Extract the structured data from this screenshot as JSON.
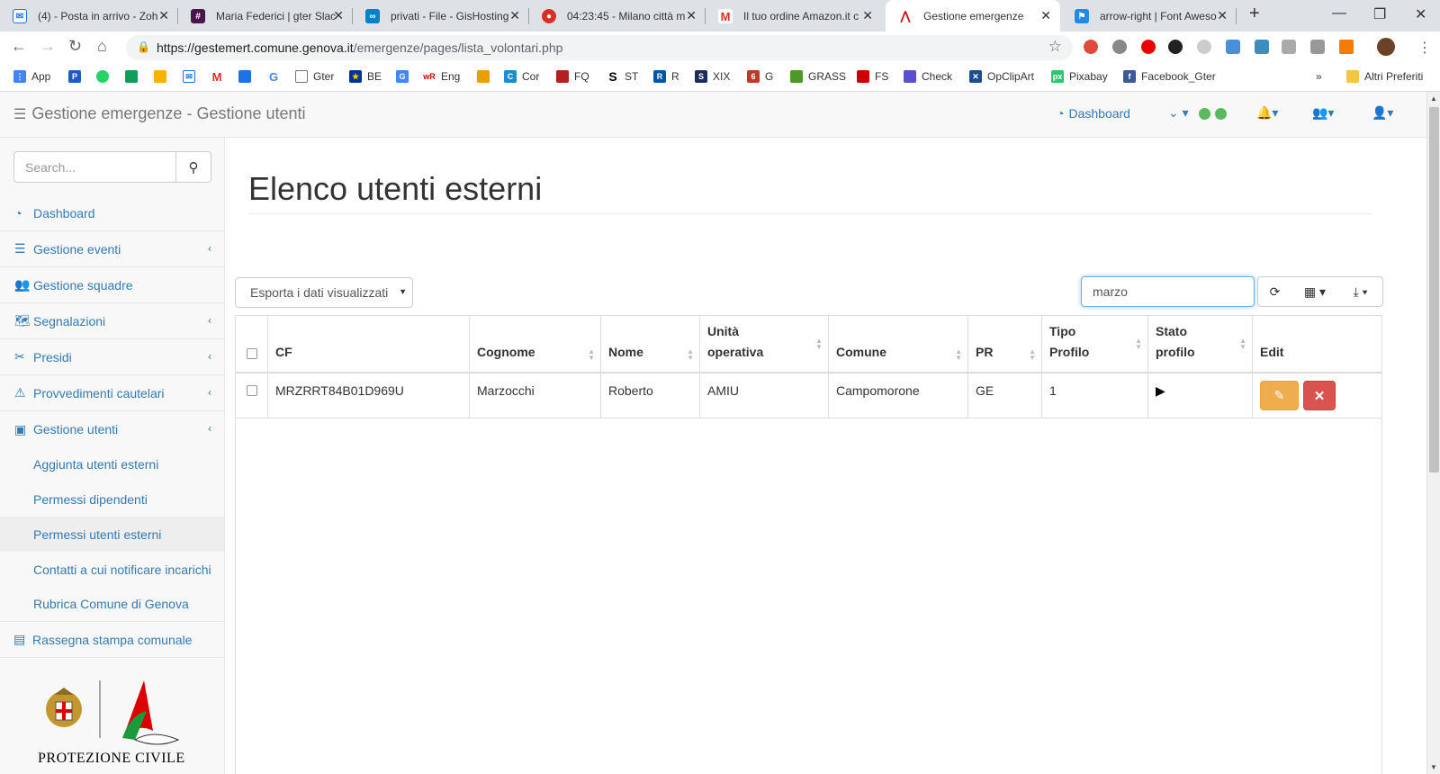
{
  "browser": {
    "tabs": [
      {
        "title": "(4) - Posta in arrivo - Zoh",
        "favicon": "mail-icon",
        "color": "#1a73e8"
      },
      {
        "title": "Maria Federici | gter Slac",
        "favicon": "slack-icon",
        "color": "#4a154b"
      },
      {
        "title": "privati - File - GisHosting",
        "favicon": "nextcloud-icon",
        "color": "#0082c9"
      },
      {
        "title": "04:23:45 - Milano città m",
        "favicon": "record-icon",
        "color": "#d93025"
      },
      {
        "title": "Il tuo ordine Amazon.it c",
        "favicon": "gmail-icon",
        "color": "#d93025"
      },
      {
        "title": "Gestione emergenze",
        "favicon": "protezione-civile-icon",
        "color": "#c00"
      },
      {
        "title": "arrow-right | Font Aweso",
        "favicon": "fontawesome-icon",
        "color": "#228ae6"
      }
    ],
    "url_host": "https://gestemert.comune.genova.it",
    "url_path": "/emergenze/pages/lista_volontari.php",
    "bookmarks": [
      {
        "label": "App",
        "color": "#4285f4"
      },
      {
        "label": "",
        "color": "#1e5bc6"
      },
      {
        "label": "",
        "color": "#25d366"
      },
      {
        "label": "",
        "color": "#fbbc04"
      },
      {
        "label": "",
        "color": "#f4b400"
      },
      {
        "label": "",
        "color": "#1a73e8"
      },
      {
        "label": "",
        "color": "#d93025"
      },
      {
        "label": "",
        "color": "#1a73e8"
      },
      {
        "label": "",
        "color": "#4285f4"
      },
      {
        "label": "Gter",
        "color": "#777"
      },
      {
        "label": "BE",
        "color": "#003399"
      },
      {
        "label": "",
        "color": "#4285f4"
      },
      {
        "label": "Eng",
        "color": "#c00"
      },
      {
        "label": "",
        "color": "#e8a000"
      },
      {
        "label": "Cor",
        "color": "#1a8ccf"
      },
      {
        "label": "FQ",
        "color": "#b22222"
      },
      {
        "label": "ST",
        "color": "#000"
      },
      {
        "label": "R",
        "color": "#0055a5"
      },
      {
        "label": "XIX",
        "color": "#1d2c5e"
      },
      {
        "label": "G",
        "color": "#c0392b"
      },
      {
        "label": "GRASS",
        "color": "#4a9a2a"
      },
      {
        "label": "FS",
        "color": "#c00"
      },
      {
        "label": "Check",
        "color": "#5a4fcf"
      },
      {
        "label": "OpClipArt",
        "color": "#1a4f8b"
      },
      {
        "label": "Pixabay",
        "color": "#2ec66d"
      },
      {
        "label": "Facebook_Gter",
        "color": "#3b5998"
      }
    ],
    "bookmarks_overflow": "»",
    "other_bookmarks": "Altri Preferiti"
  },
  "header": {
    "brand": "Gestione emergenze - Gestione utenti",
    "dashboard_link": "Dashboard",
    "status_colors": [
      "#5cb85c",
      "#5cb85c"
    ]
  },
  "sidebar": {
    "search_placeholder": "Search...",
    "items": [
      {
        "label": "Dashboard",
        "icon": "dashboard-icon",
        "chevron": false
      },
      {
        "label": "Gestione eventi",
        "icon": "list-icon",
        "chevron": true
      },
      {
        "label": "Gestione squadre",
        "icon": "users-icon",
        "chevron": false
      },
      {
        "label": "Segnalazioni",
        "icon": "map-icon",
        "chevron": true
      },
      {
        "label": "Presidi",
        "icon": "tools-icon",
        "chevron": true
      },
      {
        "label": "Provvedimenti cautelari",
        "icon": "warning-icon",
        "chevron": true
      },
      {
        "label": "Gestione utenti",
        "icon": "address-book-icon",
        "chevron": true
      }
    ],
    "sub_items": [
      {
        "label": "Aggiunta utenti esterni",
        "active": false
      },
      {
        "label": "Permessi dipendenti",
        "active": false
      },
      {
        "label": "Permessi utenti esterni",
        "active": true
      },
      {
        "label": "Contatti a cui notificare incarichi",
        "active": false
      },
      {
        "label": "Rubrica Comune di Genova",
        "active": false
      }
    ],
    "press_item": {
      "label": "Rassegna stampa comunale",
      "icon": "newspaper-icon"
    },
    "logo_caption": "PROTEZIONE CIVILE"
  },
  "main": {
    "title": "Elenco utenti esterni",
    "export_label": "Esporta i dati visualizzati",
    "table_search_value": "marzo",
    "columns": [
      "CF",
      "Cognome",
      "Nome",
      "Unità operativa",
      "Comune",
      "PR",
      "Tipo Profilo",
      "Stato profilo",
      "Edit"
    ],
    "rows": [
      {
        "cf": "MRZRRT84B01D969U",
        "cognome": "Marzocchi",
        "nome": "Roberto",
        "unita": "AMIU",
        "comune": "Campomorone",
        "pr": "GE",
        "tipo": "1",
        "stato": "▶"
      }
    ]
  },
  "colors": {
    "link": "#337ab7",
    "warning": "#f0ad4e",
    "danger": "#d9534f"
  }
}
